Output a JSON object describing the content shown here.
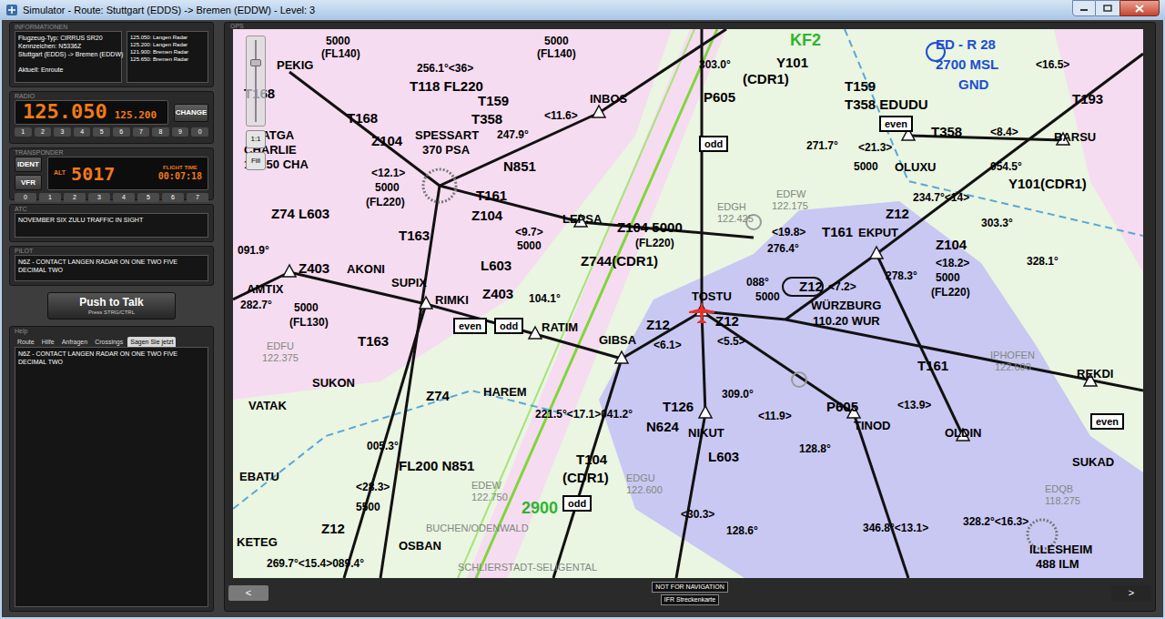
{
  "window": {
    "title": "Simulator - Route: Stuttgart (EDDS) -> Bremen (EDDW) - Level: 3"
  },
  "info": {
    "label": "INFORMATIONEN",
    "lines": [
      "Flugzeug-Typ: CIRRUS SR20",
      "Kennzeichen: N5336Z",
      "Stuttgart (EDDS) -> Bremen (EDDW)",
      "Aktuell: Enroute"
    ],
    "frequencies": [
      "125.050: Langen Radar",
      "125.200: Langen Radar",
      "121.900: Bremen Radar",
      "125.650: Bremen Radar"
    ]
  },
  "radio": {
    "label": "RADIO",
    "active": "125.050",
    "standby": "125.200",
    "change_button": "CHANGE",
    "keys": [
      "1",
      "2",
      "3",
      "4",
      "5",
      "6",
      "7",
      "8",
      "9",
      "0"
    ]
  },
  "transponder": {
    "label": "TRANSPONDER",
    "buttons": [
      "IDENT",
      "VFR"
    ],
    "alt_label": "ALT",
    "code": "5017",
    "flight_time_label": "FLIGHT TIME",
    "flight_time": "00:07:18",
    "keys": [
      "0",
      "1",
      "2",
      "3",
      "4",
      "5",
      "6",
      "7"
    ]
  },
  "atc_message": {
    "label": "ATC",
    "text": "NOVEMBER SIX ZULU TRAFFIC IN SIGHT"
  },
  "pilot_message": {
    "label": "PILOT",
    "text": "N6Z - CONTACT LANGEN RADAR ON ONE TWO FIVE DECIMAL TWO"
  },
  "push_to_talk": {
    "label": "Push to Talk",
    "hint": "Press STRG/CTRL"
  },
  "help": {
    "label": "Help",
    "tabs": [
      {
        "label": "Route",
        "selected": false
      },
      {
        "label": "Hilfe",
        "selected": false
      },
      {
        "label": "Anfragen",
        "selected": false
      },
      {
        "label": "Crossings",
        "selected": false
      },
      {
        "label": "Sagen Sie jetzt",
        "selected": true
      }
    ],
    "content": "N6Z - CONTACT LANGEN RADAR ON ONE TWO FIVE DECIMAL TWO"
  },
  "gps": {
    "label": "GPS",
    "zoom": {
      "level": 0.72,
      "buttons": [
        "1:1",
        "Fill"
      ]
    },
    "map": {
      "labels": [
        {
          "text": "5000",
          "kind": "info"
        },
        {
          "text": "(FL140)",
          "kind": "info"
        },
        {
          "text": "5000",
          "kind": "info"
        },
        {
          "text": "(FL140)",
          "kind": "info"
        },
        {
          "text": "PEKIG",
          "kind": "fix"
        },
        {
          "text": "256.1°<36>",
          "kind": "info"
        },
        {
          "text": "T118 FL220",
          "kind": "route"
        },
        {
          "text": "INBOS",
          "kind": "fix"
        },
        {
          "text": "T159",
          "kind": "route"
        },
        {
          "text": "T358",
          "kind": "route"
        },
        {
          "text": "<11.6>",
          "kind": "info"
        },
        {
          "text": "T168",
          "kind": "route"
        },
        {
          "text": "T168",
          "kind": "route"
        },
        {
          "text": "BATGA",
          "kind": "fix"
        },
        {
          "text": "CHARLIE",
          "kind": "fix"
        },
        {
          "text": "115.50 CHA",
          "kind": "fix"
        },
        {
          "text": "SPESSART",
          "kind": "fix"
        },
        {
          "text": "370 PSA",
          "kind": "fix"
        },
        {
          "text": "Z104",
          "kind": "route"
        },
        {
          "text": "247.9°",
          "kind": "info"
        },
        {
          "text": "N851",
          "kind": "route"
        },
        {
          "text": "<12.1>",
          "kind": "info"
        },
        {
          "text": "5000",
          "kind": "info"
        },
        {
          "text": "(FL220)",
          "kind": "info"
        },
        {
          "text": "T161",
          "kind": "route"
        },
        {
          "text": "Z104",
          "kind": "route"
        },
        {
          "text": "Z74 L603",
          "kind": "route"
        },
        {
          "text": "LEPSA",
          "kind": "fix"
        },
        {
          "text": "<9.7>",
          "kind": "info"
        },
        {
          "text": "5000",
          "kind": "info"
        },
        {
          "text": "Z104 5000",
          "kind": "route"
        },
        {
          "text": "(FL220)",
          "kind": "info"
        },
        {
          "text": "Z744(CDR1)",
          "kind": "route"
        },
        {
          "text": "P605",
          "kind": "route"
        },
        {
          "text": "KF2",
          "kind": "terrain"
        },
        {
          "text": "Y101",
          "kind": "route"
        },
        {
          "text": "(CDR1)",
          "kind": "route"
        },
        {
          "text": "303.0°",
          "kind": "info"
        },
        {
          "text": "T159",
          "kind": "route"
        },
        {
          "text": "T358 EDUDU",
          "kind": "route"
        },
        {
          "text": "ED - R 28",
          "kind": "restricted"
        },
        {
          "text": "2700 MSL",
          "kind": "restricted"
        },
        {
          "text": "GND",
          "kind": "restricted"
        },
        {
          "text": "271.7°",
          "kind": "info"
        },
        {
          "text": "<21.3>",
          "kind": "info"
        },
        {
          "text": "T358",
          "kind": "route"
        },
        {
          "text": "<8.4>",
          "kind": "info"
        },
        {
          "text": "BARSU",
          "kind": "fix"
        },
        {
          "text": "OLUXU",
          "kind": "fix"
        },
        {
          "text": "5000",
          "kind": "info"
        },
        {
          "text": "T193",
          "kind": "route"
        },
        {
          "text": "<16.5>",
          "kind": "info"
        },
        {
          "text": "Y101(CDR1)",
          "kind": "route"
        },
        {
          "text": "Z12",
          "kind": "route"
        },
        {
          "text": "234.7°<14>",
          "kind": "info"
        },
        {
          "text": "054.5°",
          "kind": "info"
        },
        {
          "text": "T161",
          "kind": "route"
        },
        {
          "text": "EKPUT",
          "kind": "fix"
        },
        {
          "text": "<19.8>",
          "kind": "info"
        },
        {
          "text": "276.4°",
          "kind": "info"
        },
        {
          "text": "Z104",
          "kind": "route"
        },
        {
          "text": "<18.2>",
          "kind": "info"
        },
        {
          "text": "5000",
          "kind": "info"
        },
        {
          "text": "(FL220)",
          "kind": "info"
        },
        {
          "text": "303.3°",
          "kind": "info"
        },
        {
          "text": "328.1°",
          "kind": "info"
        },
        {
          "text": "278.3°",
          "kind": "info"
        },
        {
          "text": "EDGH",
          "kind": "freq"
        },
        {
          "text": "122.425",
          "kind": "freq"
        },
        {
          "text": "EDFW",
          "kind": "freq"
        },
        {
          "text": "122.175",
          "kind": "freq"
        },
        {
          "text": "TOSTU",
          "kind": "fix"
        },
        {
          "text": "088°",
          "kind": "info"
        },
        {
          "text": "5000",
          "kind": "info"
        },
        {
          "text": "Z12",
          "kind": "route"
        },
        {
          "text": "<7.2>",
          "kind": "info"
        },
        {
          "text": "Z12",
          "kind": "route"
        },
        {
          "text": "<5.5>",
          "kind": "info"
        },
        {
          "text": "WÜRZBURG",
          "kind": "fix"
        },
        {
          "text": "110.20 WUR",
          "kind": "fix"
        },
        {
          "text": "GIBSA",
          "kind": "fix"
        },
        {
          "text": "RATIM",
          "kind": "fix"
        },
        {
          "text": "Z12",
          "kind": "route"
        },
        {
          "text": "<6.1>",
          "kind": "info"
        },
        {
          "text": "AKONI",
          "kind": "fix"
        },
        {
          "text": "SUPIX",
          "kind": "fix"
        },
        {
          "text": "RIMKI",
          "kind": "fix"
        },
        {
          "text": "Z403",
          "kind": "route"
        },
        {
          "text": "Z403",
          "kind": "route"
        },
        {
          "text": "AMTIX",
          "kind": "fix"
        },
        {
          "text": "282.7°",
          "kind": "info"
        },
        {
          "text": "5000",
          "kind": "info"
        },
        {
          "text": "(FL130)",
          "kind": "info"
        },
        {
          "text": "091.9°",
          "kind": "info"
        },
        {
          "text": "L603",
          "kind": "route"
        },
        {
          "text": "104.1°",
          "kind": "info"
        },
        {
          "text": "T163",
          "kind": "route"
        },
        {
          "text": "HAREM",
          "kind": "fix"
        },
        {
          "text": "SUKON",
          "kind": "fix"
        },
        {
          "text": "VATAK",
          "kind": "fix"
        },
        {
          "text": "T163",
          "kind": "route"
        },
        {
          "text": "NIKUT",
          "kind": "fix"
        },
        {
          "text": "T126",
          "kind": "route"
        },
        {
          "text": "N624",
          "kind": "route"
        },
        {
          "text": "P605",
          "kind": "route"
        },
        {
          "text": "TINOD",
          "kind": "fix"
        },
        {
          "text": "309.0°",
          "kind": "info"
        },
        {
          "text": "<11.9>",
          "kind": "info"
        },
        {
          "text": "128.8°",
          "kind": "info"
        },
        {
          "text": "L603",
          "kind": "route"
        },
        {
          "text": "OLDIN",
          "kind": "fix"
        },
        {
          "text": "T161",
          "kind": "route"
        },
        {
          "text": "IPHOFEN",
          "kind": "freq"
        },
        {
          "text": "122.600",
          "kind": "freq"
        },
        {
          "text": "REKDI",
          "kind": "fix"
        },
        {
          "text": "SUKAD",
          "kind": "fix"
        },
        {
          "text": "ILLESHEIM",
          "kind": "fix"
        },
        {
          "text": "488 ILM",
          "kind": "fix"
        },
        {
          "text": "EDQB",
          "kind": "freq"
        },
        {
          "text": "118.275",
          "kind": "freq"
        },
        {
          "text": "EDFU",
          "kind": "freq"
        },
        {
          "text": "122.375",
          "kind": "freq"
        },
        {
          "text": "EDEW",
          "kind": "freq"
        },
        {
          "text": "122.750",
          "kind": "freq"
        },
        {
          "text": "EDGU",
          "kind": "freq"
        },
        {
          "text": "122.600",
          "kind": "freq"
        },
        {
          "text": "BUCHEN/ODENWALD",
          "kind": "freq"
        },
        {
          "text": "SCHLIERSTADT-SELIGENTAL",
          "kind": "freq"
        },
        {
          "text": "2900",
          "kind": "terrain"
        },
        {
          "text": "KETEG",
          "kind": "fix"
        },
        {
          "text": "Z12",
          "kind": "route"
        },
        {
          "text": "269.7°<15.4>089.4°",
          "kind": "info"
        },
        {
          "text": "EBATU",
          "kind": "fix"
        },
        {
          "text": "OSBAN",
          "kind": "fix"
        },
        {
          "text": "T104",
          "kind": "route"
        },
        {
          "text": "(CDR1)",
          "kind": "route"
        },
        {
          "text": "221.5°<17.1>041.2°",
          "kind": "info"
        },
        {
          "text": "<30.3>",
          "kind": "info"
        },
        {
          "text": "128.6°",
          "kind": "info"
        },
        {
          "text": "346.8°<13.1>",
          "kind": "info"
        },
        {
          "text": "328.2°<16.3>",
          "kind": "info"
        },
        {
          "text": "Z74",
          "kind": "route"
        },
        {
          "text": "FL200 N851",
          "kind": "route"
        },
        {
          "text": "5500",
          "kind": "info"
        },
        {
          "text": "<28.3>",
          "kind": "info"
        },
        {
          "text": "005.3°",
          "kind": "info"
        },
        {
          "text": "even",
          "kind": "even"
        },
        {
          "text": "odd",
          "kind": "odd"
        },
        {
          "text": "odd",
          "kind": "odd"
        },
        {
          "text": "even",
          "kind": "even"
        },
        {
          "text": "odd",
          "kind": "odd"
        },
        {
          "text": "even",
          "kind": "even"
        },
        {
          "text": "<13.9>",
          "kind": "info"
        }
      ]
    },
    "footer": {
      "notice": "NOT FOR NAVIGATION",
      "chart": "IFR Streckenkarte"
    },
    "nav": {
      "prev": "<",
      "next": ">"
    }
  }
}
